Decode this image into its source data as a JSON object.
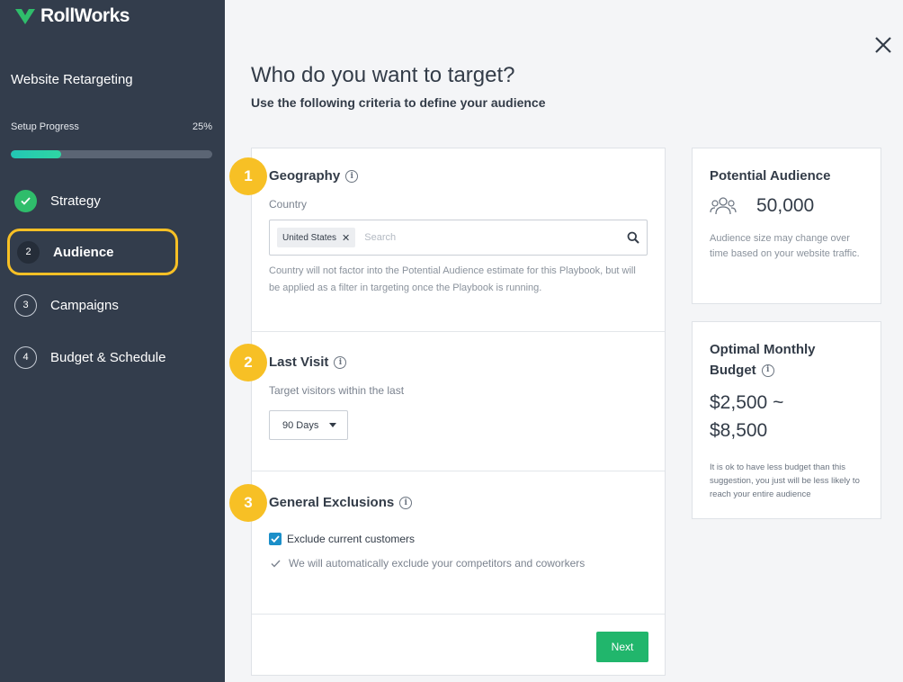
{
  "brand": {
    "name": "RollWorks",
    "color": "#2fbd6b"
  },
  "sidebar": {
    "program_title": "Website Retargeting",
    "progress": {
      "label": "Setup Progress",
      "percent_text": "25%",
      "value": 0.25
    },
    "steps": [
      {
        "number": "",
        "label": "Strategy",
        "state": "done"
      },
      {
        "number": "2",
        "label": "Audience",
        "state": "current"
      },
      {
        "number": "3",
        "label": "Campaigns",
        "state": "todo"
      },
      {
        "number": "4",
        "label": "Budget & Schedule",
        "state": "todo"
      }
    ]
  },
  "main": {
    "title": "Who do you want to target?",
    "subtitle": "Use the following criteria to define your audience",
    "sections": {
      "geography": {
        "number": "1",
        "title": "Geography",
        "field_label": "Country",
        "chip": "United States",
        "search_placeholder": "Search",
        "helper": "Country will not factor into the Potential Audience estimate for this Playbook, but will be applied as a filter in targeting once the Playbook is running."
      },
      "last_visit": {
        "number": "2",
        "title": "Last Visit",
        "field_label": "Target visitors within the last",
        "selected": "90 Days"
      },
      "exclusions": {
        "number": "3",
        "title": "General Exclusions",
        "checkbox_label": "Exclude current customers",
        "checked": true,
        "auto_note": "We will automatically exclude your competitors and coworkers"
      }
    },
    "next_label": "Next"
  },
  "potential_audience": {
    "title": "Potential Audience",
    "count": "50,000",
    "note": "Audience size may change over time based on your website traffic."
  },
  "optimal_budget": {
    "title_line1": "Optimal Monthly",
    "title_line2": "Budget",
    "range_low": "$2,500 ~",
    "range_high": "$8,500",
    "note": "It is ok to have less budget than this suggestion, you just will be less likely to reach your entire audience"
  },
  "colors": {
    "accent_yellow": "#f7c025",
    "success_green": "#21b66c",
    "checkbox_blue": "#1b8fc9",
    "sidebar_bg": "#333d4c"
  },
  "icons": [
    "brand-logo-icon",
    "check-icon",
    "close-icon",
    "info-icon",
    "remove-icon",
    "search-icon",
    "caret-down-icon",
    "people-icon"
  ]
}
